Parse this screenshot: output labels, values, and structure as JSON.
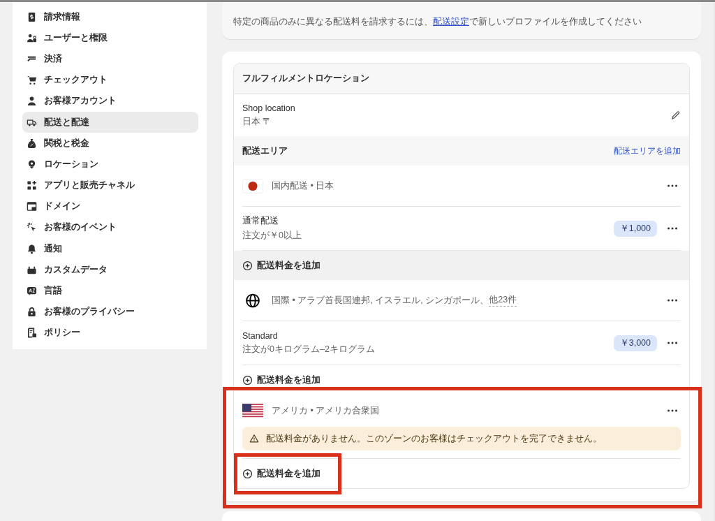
{
  "sidebar": {
    "items": [
      {
        "label": "請求情報",
        "selected": false
      },
      {
        "label": "ユーザーと権限",
        "selected": false
      },
      {
        "label": "決済",
        "selected": false
      },
      {
        "label": "チェックアウト",
        "selected": false
      },
      {
        "label": "お客様アカウント",
        "selected": false
      },
      {
        "label": "配送と配達",
        "selected": true
      },
      {
        "label": "関税と税金",
        "selected": false
      },
      {
        "label": "ロケーション",
        "selected": false
      },
      {
        "label": "アプリと販売チャネル",
        "selected": false
      },
      {
        "label": "ドメイン",
        "selected": false
      },
      {
        "label": "お客様のイベント",
        "selected": false
      },
      {
        "label": "通知",
        "selected": false
      },
      {
        "label": "カスタムデータ",
        "selected": false
      },
      {
        "label": "言語",
        "selected": false
      },
      {
        "label": "お客様のプライバシー",
        "selected": false
      },
      {
        "label": "ポリシー",
        "selected": false
      }
    ]
  },
  "notice": {
    "before": "特定の商品のみに異なる配送料を請求するには、",
    "link": "配送設定",
    "after": "で新しいプロファイルを作成してください"
  },
  "fulfillment": {
    "title": "フルフィルメントロケーション",
    "location_name": "Shop location",
    "location_address": "日本 〒"
  },
  "zones_header": {
    "title": "配送エリア",
    "add_link": "配送エリアを追加"
  },
  "zones": [
    {
      "title": "国内配送 • 日本",
      "rates": [
        {
          "name": "通常配送",
          "condition": "注文が￥0以上",
          "price": "￥1,000"
        }
      ],
      "add_rate": {
        "label": "配送料金を追加",
        "hovered": true,
        "highlighted": false
      },
      "highlighted": false
    },
    {
      "title": "国際 • アラブ首長国連邦, イスラエル, シンガポール、",
      "others": "他23件",
      "rates": [
        {
          "name": "Standard",
          "condition": "注文が0キログラム–2キログラム",
          "price": "￥3,000"
        }
      ],
      "add_rate": {
        "label": "配送料金を追加",
        "hovered": false,
        "highlighted": false
      },
      "highlighted": false
    },
    {
      "title": "アメリカ • アメリカ合衆国",
      "warning": "配送料金がありません。このゾーンのお客様はチェックアウトを完了できません。",
      "add_rate": {
        "label": "配送料金を追加",
        "hovered": false,
        "highlighted": true
      },
      "highlighted": true
    }
  ]
}
